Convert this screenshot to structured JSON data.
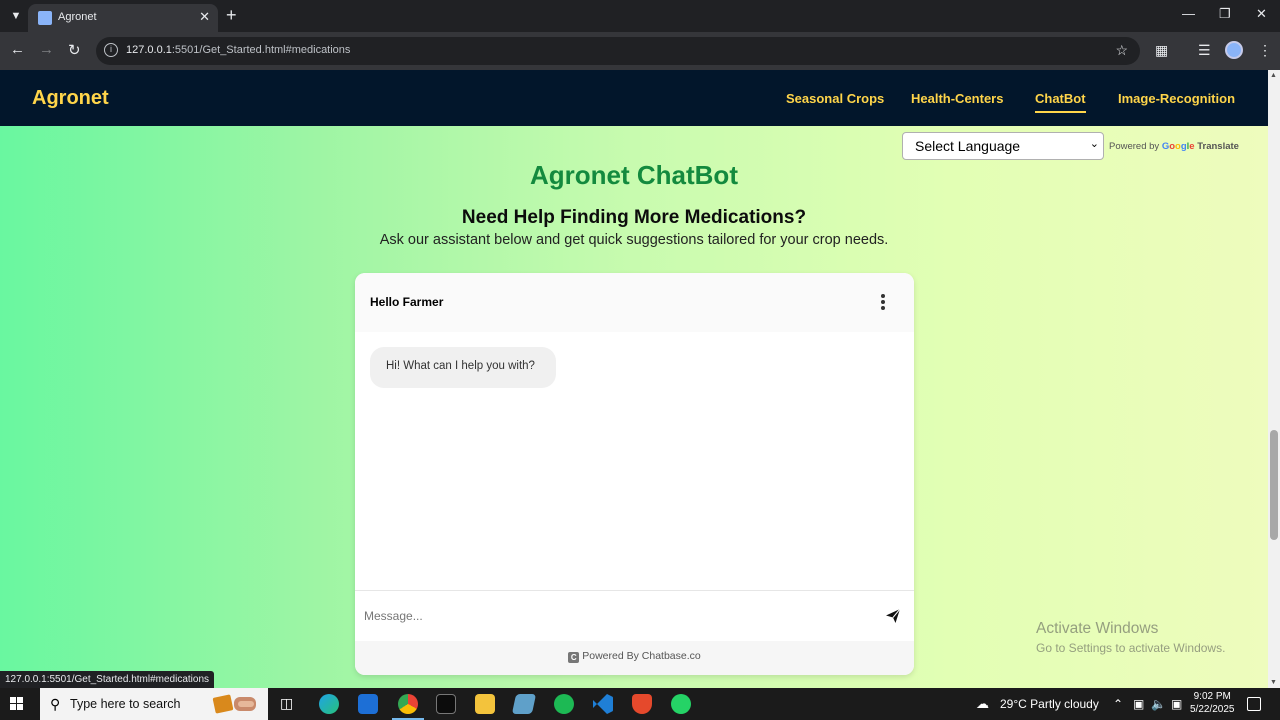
{
  "browser": {
    "tab_title": "Agronet",
    "url_host": "127.0.0.1",
    "url_rest": ":5501/Get_Started.html#medications",
    "status_url": "127.0.0.1:5501/Get_Started.html#medications"
  },
  "site": {
    "brand": "Agronet",
    "nav": [
      {
        "label": "Seasonal Crops",
        "active": false
      },
      {
        "label": "Health-Centers",
        "active": false
      },
      {
        "label": "ChatBot",
        "active": true
      },
      {
        "label": "Image-Recognition",
        "active": false
      }
    ],
    "language_select": "Select Language",
    "powered_by": "Powered by",
    "google": "Google",
    "translate": "Translate"
  },
  "section": {
    "title": "Agronet ChatBot",
    "heading": "Need Help Finding More Medications?",
    "subtitle": "Ask our assistant below and get quick suggestions tailored for your crop needs."
  },
  "chat": {
    "header": "Hello Farmer",
    "bot_message": "Hi! What can I help you with?",
    "input_placeholder": "Message...",
    "footer": "Powered By Chatbase.co"
  },
  "watermark": {
    "line1": "Activate Windows",
    "line2": "Go to Settings to activate Windows."
  },
  "taskbar": {
    "search_placeholder": "Type here to search",
    "weather": "29°C  Partly cloudy",
    "time": "9:02 PM",
    "date": "5/22/2025"
  },
  "colors": {
    "nav_bg": "#02162b",
    "brand_yellow": "#ffd54a",
    "title_green": "#138a3e"
  }
}
